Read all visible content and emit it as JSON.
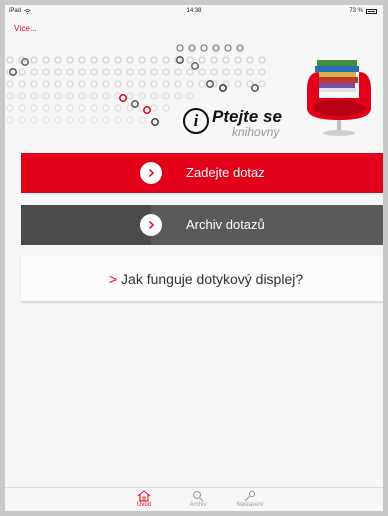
{
  "status": {
    "device": "iPad",
    "time": "14:38",
    "battery": "73 %"
  },
  "nav": {
    "back_label": "Více..."
  },
  "logo": {
    "line1": "Ptejte se",
    "line2": "knihovny",
    "i_mark": "i"
  },
  "buttons": {
    "ask_label": "Zadejte dotaz",
    "archive_label": "Archiv dotazů",
    "touch_prefix": ">",
    "touch_label": "Jak funguje dotykový displej?"
  },
  "tabs": [
    {
      "label": "Úvod",
      "icon": "home-icon",
      "active": true
    },
    {
      "label": "Archiv",
      "icon": "search-icon",
      "active": false
    },
    {
      "label": "Nastavení",
      "icon": "wrench-icon",
      "active": false
    }
  ],
  "colors": {
    "accent": "#e2001a",
    "dark": "#5a5a5a",
    "background": "#f7f7f7"
  }
}
